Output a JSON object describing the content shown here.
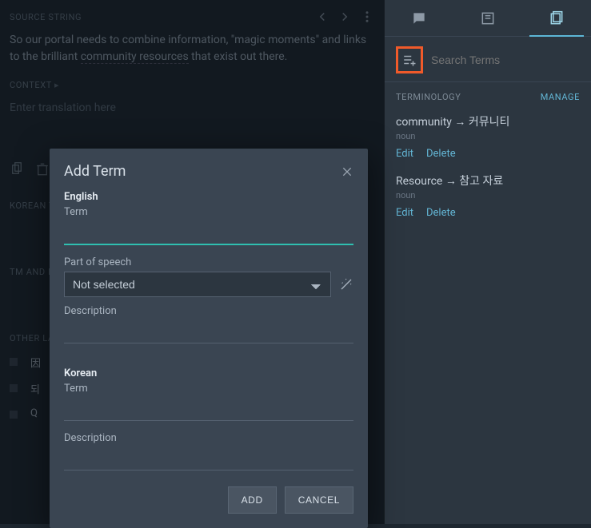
{
  "source": {
    "label": "SOURCE STRING",
    "text_pre": "So our portal needs to combine information, \"magic moments\" and links to the brilliant ",
    "text_underlined": "community resources",
    "text_post": " that exist out there.",
    "context_label": "CONTEXT",
    "translation_placeholder": "Enter translation here"
  },
  "sections": {
    "korean": "KOREAN T",
    "tm": "TM AND M",
    "other": "OTHER LA"
  },
  "other_items": [
    "因",
    "되",
    "Q"
  ],
  "right": {
    "search_placeholder": "Search Terms",
    "terminology_label": "TERMINOLOGY",
    "manage_label": "MANAGE",
    "terms": [
      {
        "word": "community → 커뮤니티",
        "pos": "noun",
        "edit": "Edit",
        "delete": "Delete"
      },
      {
        "word": "Resource → 참고 자료",
        "pos": "noun",
        "edit": "Edit",
        "delete": "Delete"
      }
    ]
  },
  "modal": {
    "title": "Add Term",
    "lang_en": "English",
    "term_label": "Term",
    "pos_label": "Part of speech",
    "pos_selected": "Not selected",
    "desc_label": "Description",
    "lang_ko": "Korean",
    "add_btn": "ADD",
    "cancel_btn": "CANCEL"
  }
}
